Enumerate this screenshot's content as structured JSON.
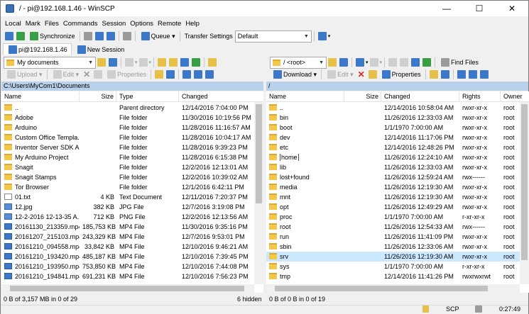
{
  "window": {
    "title": "/ - pi@192.168.1.46 - WinSCP",
    "minimize": "—",
    "maximize": "☐",
    "close": "✕"
  },
  "menu": [
    "Local",
    "Mark",
    "Files",
    "Commands",
    "Session",
    "Options",
    "Remote",
    "Help"
  ],
  "toolbar": {
    "synchronize": "Synchronize",
    "queue": "Queue",
    "transfer_settings": "Transfer Settings",
    "transfer_value": "Default"
  },
  "tabs": {
    "session": "pi@192.168.1.46",
    "new_session": "New Session"
  },
  "left": {
    "location": "My documents",
    "upload": "Upload",
    "edit": "Edit",
    "properties": "Properties",
    "path": "C:\\Users\\MyCom1\\Documents",
    "columns": {
      "name": "Name",
      "size": "Size",
      "type": "Type",
      "changed": "Changed"
    },
    "rows": [
      {
        "icon": "up",
        "name": "..",
        "size": "",
        "type": "Parent directory",
        "changed": "12/14/2016  7:04:00 PM"
      },
      {
        "icon": "folder",
        "name": "Adobe",
        "size": "",
        "type": "File folder",
        "changed": "11/30/2016  10:19:56 PM"
      },
      {
        "icon": "folder",
        "name": "Arduino",
        "size": "",
        "type": "File folder",
        "changed": "11/28/2016  11:16:57 AM"
      },
      {
        "icon": "folder",
        "name": "Custom Office Templa...",
        "size": "",
        "type": "File folder",
        "changed": "11/28/2016  10:04:17 AM"
      },
      {
        "icon": "folder",
        "name": "Inventor Server SDK A...",
        "size": "",
        "type": "File folder",
        "changed": "11/28/2016  9:39:23 PM"
      },
      {
        "icon": "folder",
        "name": "My Arduino Project",
        "size": "",
        "type": "File folder",
        "changed": "11/28/2016  6:15:38 PM"
      },
      {
        "icon": "folder",
        "name": "Snagit",
        "size": "",
        "type": "File folder",
        "changed": "12/2/2016  12:13:01 AM"
      },
      {
        "icon": "folder",
        "name": "Snagit Stamps",
        "size": "",
        "type": "File folder",
        "changed": "12/2/2016  10:39:02 AM"
      },
      {
        "icon": "folder",
        "name": "Tor Browser",
        "size": "",
        "type": "File folder",
        "changed": "12/1/2016  6:42:11 PM"
      },
      {
        "icon": "txt",
        "name": "01.txt",
        "size": "4 KB",
        "type": "Text Document",
        "changed": "12/11/2016  7:20:37 PM"
      },
      {
        "icon": "img",
        "name": "12.jpg",
        "size": "382 KB",
        "type": "JPG File",
        "changed": "12/7/2016  3:19:08 PM"
      },
      {
        "icon": "img",
        "name": "12-2-2016 12-13-35 A...",
        "size": "712 KB",
        "type": "PNG File",
        "changed": "12/2/2016  12:13:56 AM"
      },
      {
        "icon": "mp4",
        "name": "20161130_213359.mp4",
        "size": "185,753 KB",
        "type": "MP4 File",
        "changed": "11/30/2016  9:35:16 PM"
      },
      {
        "icon": "mp4",
        "name": "20161207_215103.mp4",
        "size": "243,329 KB",
        "type": "MP4 File",
        "changed": "12/7/2016  9:53:01 PM"
      },
      {
        "icon": "mp4",
        "name": "20161210_094558.mp4",
        "size": "33,842 KB",
        "type": "MP4 File",
        "changed": "12/10/2016  9:46:21 AM"
      },
      {
        "icon": "mp4",
        "name": "20161210_193420.mp4",
        "size": "485,187 KB",
        "type": "MP4 File",
        "changed": "12/10/2016  7:39:45 PM"
      },
      {
        "icon": "mp4",
        "name": "20161210_193950.mp4",
        "size": "753,850 KB",
        "type": "MP4 File",
        "changed": "12/10/2016  7:44:08 PM"
      },
      {
        "icon": "mp4",
        "name": "20161210_194841.mp4",
        "size": "691,231 KB",
        "type": "MP4 File",
        "changed": "12/10/2016  7:56:23 PM"
      }
    ],
    "status": "0 B of 3,157 MB in 0 of 29",
    "hidden": "6 hidden"
  },
  "right": {
    "location": "/ <root>",
    "find_files": "Find Files",
    "download": "Download",
    "edit": "Edit",
    "properties": "Properties",
    "path": "/",
    "columns": {
      "name": "Name",
      "size": "Size",
      "changed": "Changed",
      "rights": "Rights",
      "owner": "Owner"
    },
    "rows": [
      {
        "name": "..",
        "changed": "12/14/2016  10:58:04 AM",
        "rights": "rwxr-xr-x",
        "owner": "root"
      },
      {
        "name": "bin",
        "changed": "11/26/2016  12:33:03 AM",
        "rights": "rwxr-xr-x",
        "owner": "root"
      },
      {
        "name": "boot",
        "changed": "1/1/1970  7:00:00 AM",
        "rights": "rwxr-xr-x",
        "owner": "root"
      },
      {
        "name": "dev",
        "changed": "12/14/2016  11:17:06 PM",
        "rights": "rwxr-xr-x",
        "owner": "root"
      },
      {
        "name": "etc",
        "changed": "12/14/2016  12:48:26 PM",
        "rights": "rwxr-xr-x",
        "owner": "root"
      },
      {
        "name": "home",
        "changed": "11/26/2016  12:24:10 AM",
        "rights": "rwxr-xr-x",
        "owner": "root"
      },
      {
        "name": "lib",
        "changed": "11/26/2016  12:33:03 AM",
        "rights": "rwxr-xr-x",
        "owner": "root"
      },
      {
        "name": "lost+found",
        "changed": "11/26/2016  12:59:24 AM",
        "rights": "rwx------",
        "owner": "root"
      },
      {
        "name": "media",
        "changed": "11/26/2016  12:19:30 AM",
        "rights": "rwxr-xr-x",
        "owner": "root"
      },
      {
        "name": "mnt",
        "changed": "11/26/2016  12:19:30 AM",
        "rights": "rwxr-xr-x",
        "owner": "root"
      },
      {
        "name": "opt",
        "changed": "11/26/2016  12:49:29 AM",
        "rights": "rwxr-xr-x",
        "owner": "root"
      },
      {
        "name": "proc",
        "changed": "1/1/1970  7:00:00 AM",
        "rights": "r-xr-xr-x",
        "owner": "root"
      },
      {
        "name": "root",
        "changed": "11/26/2016  12:54:33 AM",
        "rights": "rwx------",
        "owner": "root"
      },
      {
        "name": "run",
        "changed": "11/26/2016  11:41:09 PM",
        "rights": "rwxr-xr-x",
        "owner": "root"
      },
      {
        "name": "sbin",
        "changed": "11/26/2016  12:33:06 AM",
        "rights": "rwxr-xr-x",
        "owner": "root"
      },
      {
        "name": "srv",
        "changed": "11/26/2016  12:19:30 AM",
        "rights": "rwxr-xr-x",
        "owner": "root"
      },
      {
        "name": "sys",
        "changed": "1/1/1970  7:00:00 AM",
        "rights": "r-xr-xr-x",
        "owner": "root"
      },
      {
        "name": "tmp",
        "changed": "12/14/2016  11:41:26 PM",
        "rights": "rwxrwxrwt",
        "owner": "root"
      }
    ],
    "status": "0 B of 0 B in 0 of 19"
  },
  "statusbar": {
    "protocol": "SCP",
    "time": "0:27:49"
  },
  "colors": {
    "path_bar": "#b9d1ea",
    "selection": "#cce8ff"
  }
}
